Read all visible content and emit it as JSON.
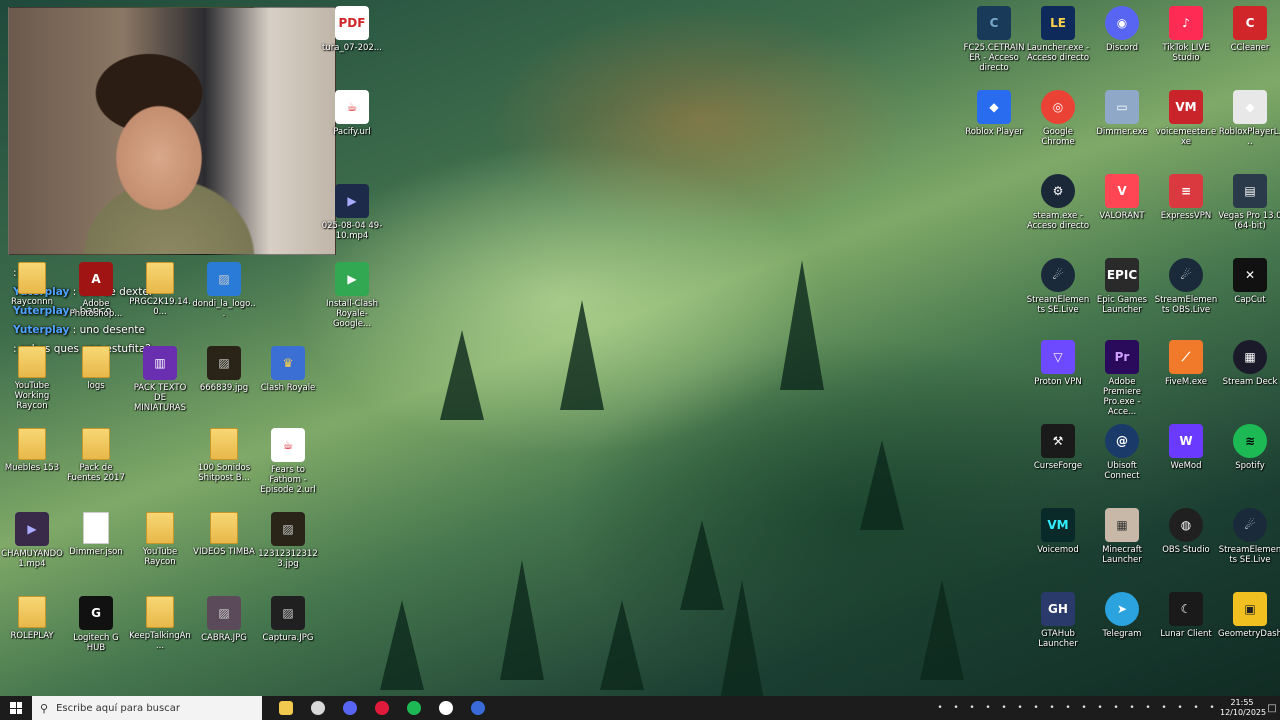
{
  "chat": [
    {
      "user": "",
      "text": ": god"
    },
    {
      "user": "Yuterplay",
      "text": " : uno de dexter"
    },
    {
      "user": "Yuterplay",
      "text": " : banco"
    },
    {
      "user": "Yuterplay",
      "text": " : uno desente"
    },
    {
      "user": "",
      "text": " : sabes ques una estufita?"
    }
  ],
  "desktop_left": [
    {
      "label": "tura_07-202...",
      "icon": "pdf-icon",
      "color": "#ffffff"
    },
    {
      "label": "Pacify.url",
      "icon": "java-icon",
      "color": "#ffffff"
    },
    {
      "label": "025-08-04 49-10.mp4",
      "icon": "video-icon",
      "color": "#1e2a4a"
    },
    {
      "label": "Rayconnn",
      "icon": "folder-icon",
      "color": "#f0c94e"
    },
    {
      "label": "Adobe Photoshop...",
      "icon": "app-icon",
      "color": "#a01414"
    },
    {
      "label": "PRGC2K19.14.0...",
      "icon": "folder-icon",
      "color": "#f0c94e"
    },
    {
      "label": "dondi_la_logo...",
      "icon": "image-icon",
      "color": "#2a7bd8"
    },
    {
      "label": "Install-Clash Royale-Google...",
      "icon": "google-play-icon",
      "color": "#33a852"
    },
    {
      "label": "YouTube Working Raycon",
      "icon": "folder-icon",
      "color": "#f0c94e"
    },
    {
      "label": "logs",
      "icon": "folder-icon",
      "color": "#f0c94e"
    },
    {
      "label": "PACK TEXTO DE MINIATURAS",
      "icon": "archive-icon",
      "color": "#6a2fb0"
    },
    {
      "label": "666839.jpg",
      "icon": "image-icon",
      "color": "#2a2418"
    },
    {
      "label": "Clash Royale",
      "icon": "clash-royale-icon",
      "color": "#3b6fd4"
    },
    {
      "label": "Muebles 153",
      "icon": "folder-icon",
      "color": "#f0c94e"
    },
    {
      "label": "Pack de Fuentes 2017",
      "icon": "folder-icon",
      "color": "#f0c94e"
    },
    {
      "label": "100 Sonidos Shitpost B...",
      "icon": "folder-icon",
      "color": "#f0c94e"
    },
    {
      "label": "Fears to Fathom - Episode 2.url",
      "icon": "java-icon",
      "color": "#ffffff"
    },
    {
      "label": "CHAMUYANDO 1.mp4",
      "icon": "video-icon",
      "color": "#3a2a4a"
    },
    {
      "label": "Dimmer.json",
      "icon": "file-icon",
      "color": "#ffffff"
    },
    {
      "label": "YouTube Raycon",
      "icon": "folder-icon",
      "color": "#f0c94e"
    },
    {
      "label": "VIDEOS TIMBA",
      "icon": "folder-icon",
      "color": "#f0c94e"
    },
    {
      "label": "123123123123.jpg",
      "icon": "image-icon",
      "color": "#2a2418"
    },
    {
      "label": "ROLEPLAY",
      "icon": "folder-icon",
      "color": "#f0c94e"
    },
    {
      "label": "Logitech G HUB",
      "icon": "logitech-icon",
      "color": "#111111"
    },
    {
      "label": "KeepTalkingAn...",
      "icon": "folder-icon",
      "color": "#f0c94e"
    },
    {
      "label": "CABRA.JPG",
      "icon": "image-icon",
      "color": "#5a4a5a"
    },
    {
      "label": "Captura.JPG",
      "icon": "image-icon",
      "color": "#202020"
    }
  ],
  "desktop_right": [
    {
      "label": "FC25.CETRAINER - Acceso directo",
      "icon": "cheat-engine-icon",
      "color": "#1a3a5a"
    },
    {
      "label": "Launcher.exe - Acceso directo",
      "icon": "fc25-icon",
      "color": "#0e2a5a"
    },
    {
      "label": "Discord",
      "icon": "discord-icon",
      "color": "#5865f2"
    },
    {
      "label": "TikTok LIVE Studio",
      "icon": "tiktok-icon",
      "color": "#fe2c55"
    },
    {
      "label": "CCleaner",
      "icon": "ccleaner-icon",
      "color": "#d0262a"
    },
    {
      "label": "Roblox Player",
      "icon": "roblox-icon",
      "color": "#2a6cf0"
    },
    {
      "label": "Google Chrome",
      "icon": "chrome-icon",
      "color": "#ea4335"
    },
    {
      "label": "Dimmer.exe",
      "icon": "monitor-icon",
      "color": "#8fa8c8"
    },
    {
      "label": "voicemeeter.exe",
      "icon": "voicemeeter-icon",
      "color": "#c8242a"
    },
    {
      "label": "RobloxPlayerL...",
      "icon": "roblox-icon",
      "color": "#e8e8e8"
    },
    {
      "label": "steam.exe - Acceso directo",
      "icon": "steam-icon",
      "color": "#1b2838"
    },
    {
      "label": "VALORANT",
      "icon": "valorant-icon",
      "color": "#ff4655"
    },
    {
      "label": "ExpressVPN",
      "icon": "expressvpn-icon",
      "color": "#da3940"
    },
    {
      "label": "Vegas Pro 13.0 (64-bit)",
      "icon": "vegas-icon",
      "color": "#2a3a4a"
    },
    {
      "label": "StreamElements SE.Live",
      "icon": "streamelements-icon",
      "color": "#1a2a3a"
    },
    {
      "label": "Epic Games Launcher",
      "icon": "epic-games-icon",
      "color": "#2a2a2a"
    },
    {
      "label": "StreamElements OBS.Live",
      "icon": "streamelements-icon",
      "color": "#1a2a3a"
    },
    {
      "label": "CapCut",
      "icon": "capcut-icon",
      "color": "#111111"
    },
    {
      "label": "Proton VPN",
      "icon": "protonvpn-icon",
      "color": "#6d4aff"
    },
    {
      "label": "Adobe Premiere Pro.exe - Acce...",
      "icon": "premiere-icon",
      "color": "#2a0a5a"
    },
    {
      "label": "FiveM.exe",
      "icon": "fivem-icon",
      "color": "#f07a2a"
    },
    {
      "label": "Stream Deck",
      "icon": "stream-deck-icon",
      "color": "#1a1a2a"
    },
    {
      "label": "CurseForge",
      "icon": "curseforge-icon",
      "color": "#1a1a1a"
    },
    {
      "label": "Ubisoft Connect",
      "icon": "ubisoft-icon",
      "color": "#1a3a6a"
    },
    {
      "label": "WeMod",
      "icon": "wemod-icon",
      "color": "#6a3aff"
    },
    {
      "label": "Spotify",
      "icon": "spotify-icon",
      "color": "#1db954"
    },
    {
      "label": "Voicemod",
      "icon": "voicemod-icon",
      "color": "#0a2a2a"
    },
    {
      "label": "Minecraft Launcher",
      "icon": "minecraft-icon",
      "color": "#c8b8a8"
    },
    {
      "label": "OBS Studio",
      "icon": "obs-icon",
      "color": "#202020"
    },
    {
      "label": "StreamElements SE.Live",
      "icon": "streamelements-icon",
      "color": "#1a2a3a"
    },
    {
      "label": "GTAHub Launcher",
      "icon": "gtahub-icon",
      "color": "#2a3a6a"
    },
    {
      "label": "Telegram",
      "icon": "telegram-icon",
      "color": "#2aa3df"
    },
    {
      "label": "Lunar Client",
      "icon": "lunar-client-icon",
      "color": "#1a1a1a"
    },
    {
      "label": "GeometryDash",
      "icon": "geometry-dash-icon",
      "color": "#f0c020"
    }
  ],
  "taskbar": {
    "search_placeholder": "Escribe aquí para buscar",
    "pinned": [
      {
        "name": "file-explorer-icon",
        "color": "#f0c94e"
      },
      {
        "name": "streamelements-icon",
        "color": "#d8d8d8"
      },
      {
        "name": "discord-icon",
        "color": "#5865f2"
      },
      {
        "name": "opera-gx-icon",
        "color": "#e01a3a"
      },
      {
        "name": "spotify-icon",
        "color": "#1db954"
      },
      {
        "name": "g-hub-icon",
        "color": "#ffffff"
      },
      {
        "name": "app-icon",
        "color": "#3a6ad8"
      }
    ],
    "tray_icons": [
      "obs-icon",
      "settings-icon",
      "steam-icon",
      "network-icon",
      "cloud-icon",
      "vpn-icon",
      "nvidia-icon",
      "spotify-icon",
      "discord-icon",
      "security-icon",
      "bluetooth-icon",
      "chevron-icon",
      "gear-icon",
      "speaker-icon",
      "volume-icon",
      "battery-icon",
      "keyboard-icon",
      "display-icon"
    ],
    "time": "21:55",
    "date": "12/10/2025"
  }
}
